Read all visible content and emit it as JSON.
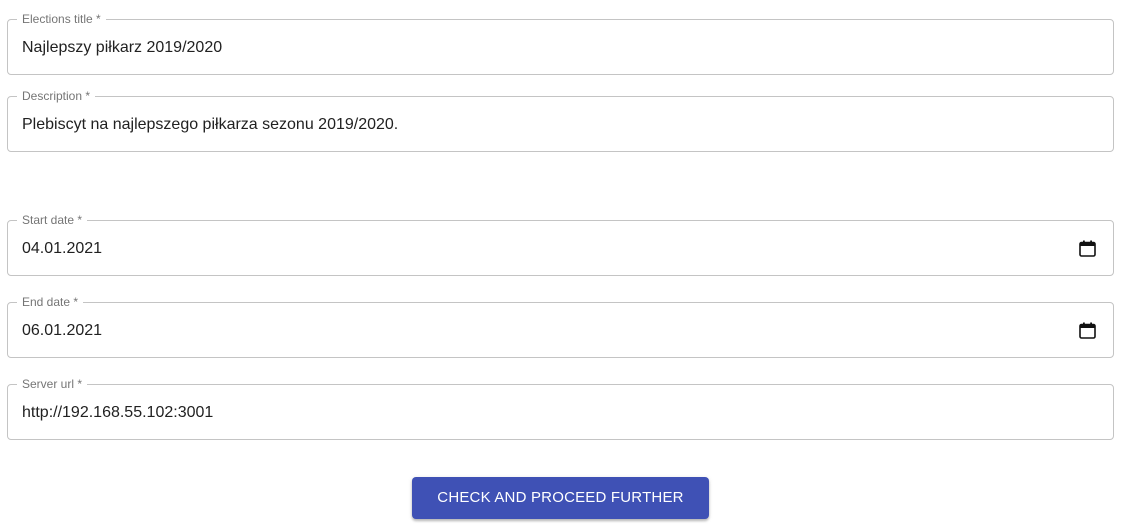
{
  "form": {
    "title_field": {
      "label": "Elections title *",
      "value": "Najlepszy piłkarz 2019/2020"
    },
    "description_field": {
      "label": "Description *",
      "value": "Plebiscyt na najlepszego piłkarza sezonu 2019/2020."
    },
    "start_date_field": {
      "label": "Start date *",
      "value": "04.01.2021",
      "icon": "calendar-icon"
    },
    "end_date_field": {
      "label": "End date *",
      "value": "06.01.2021",
      "icon": "calendar-icon"
    },
    "server_url_field": {
      "label": "Server url *",
      "value": "http://192.168.55.102:3001"
    },
    "submit_button": {
      "label": "CHECK AND PROCEED FURTHER"
    }
  },
  "colors": {
    "primary": "#3f51b5",
    "border": "#c4c4c4",
    "label": "#757575",
    "text": "#212121"
  }
}
